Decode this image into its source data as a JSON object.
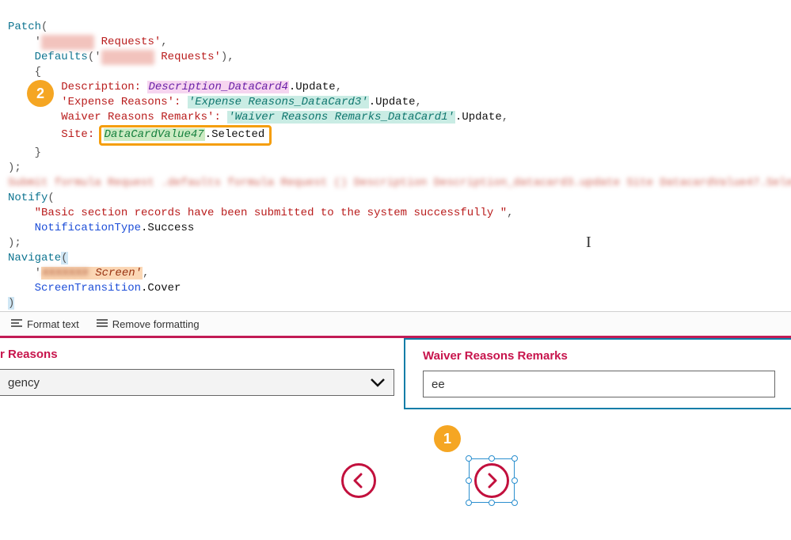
{
  "code": {
    "patch": "Patch",
    "defaults": "Defaults",
    "notify": "Notify",
    "navigate": "Navigate",
    "requests_suffix": " Requests'",
    "desc_label": "Description: ",
    "desc_val": "Description_DataCard4",
    "exp_label": "'Expense Reasons': ",
    "exp_val": "'Expense Reasons_DataCard3'",
    "waiv_label": "Waiver Reasons Remarks': ",
    "waiv_val": "'Waiver Reasons Remarks_DataCard1'",
    "site_label": "Site: ",
    "site_val": "DataCardValue47",
    "update": ".Update",
    "selected": ".Selected",
    "notify_msg": "\"Basic section records have been submitted to the system successfully \"",
    "notif_type": "NotificationType",
    "notif_mem": ".Success",
    "screen_suffix": " Screen'",
    "trans": "ScreenTransition",
    "trans_mem": ".Cover",
    "quote": "'",
    "comma": ",",
    "open_brace": "{",
    "close_brace": "}",
    "open_paren": "(",
    "close_paren": ")",
    "semicolon": ";"
  },
  "toolbar": {
    "format": "Format text",
    "remove": "Remove formatting"
  },
  "cards": {
    "left_label": "r Reasons",
    "left_value": "gency",
    "right_label": "Waiver Reasons Remarks",
    "right_value": "ee"
  },
  "callouts": {
    "one": "1",
    "two": "2"
  }
}
